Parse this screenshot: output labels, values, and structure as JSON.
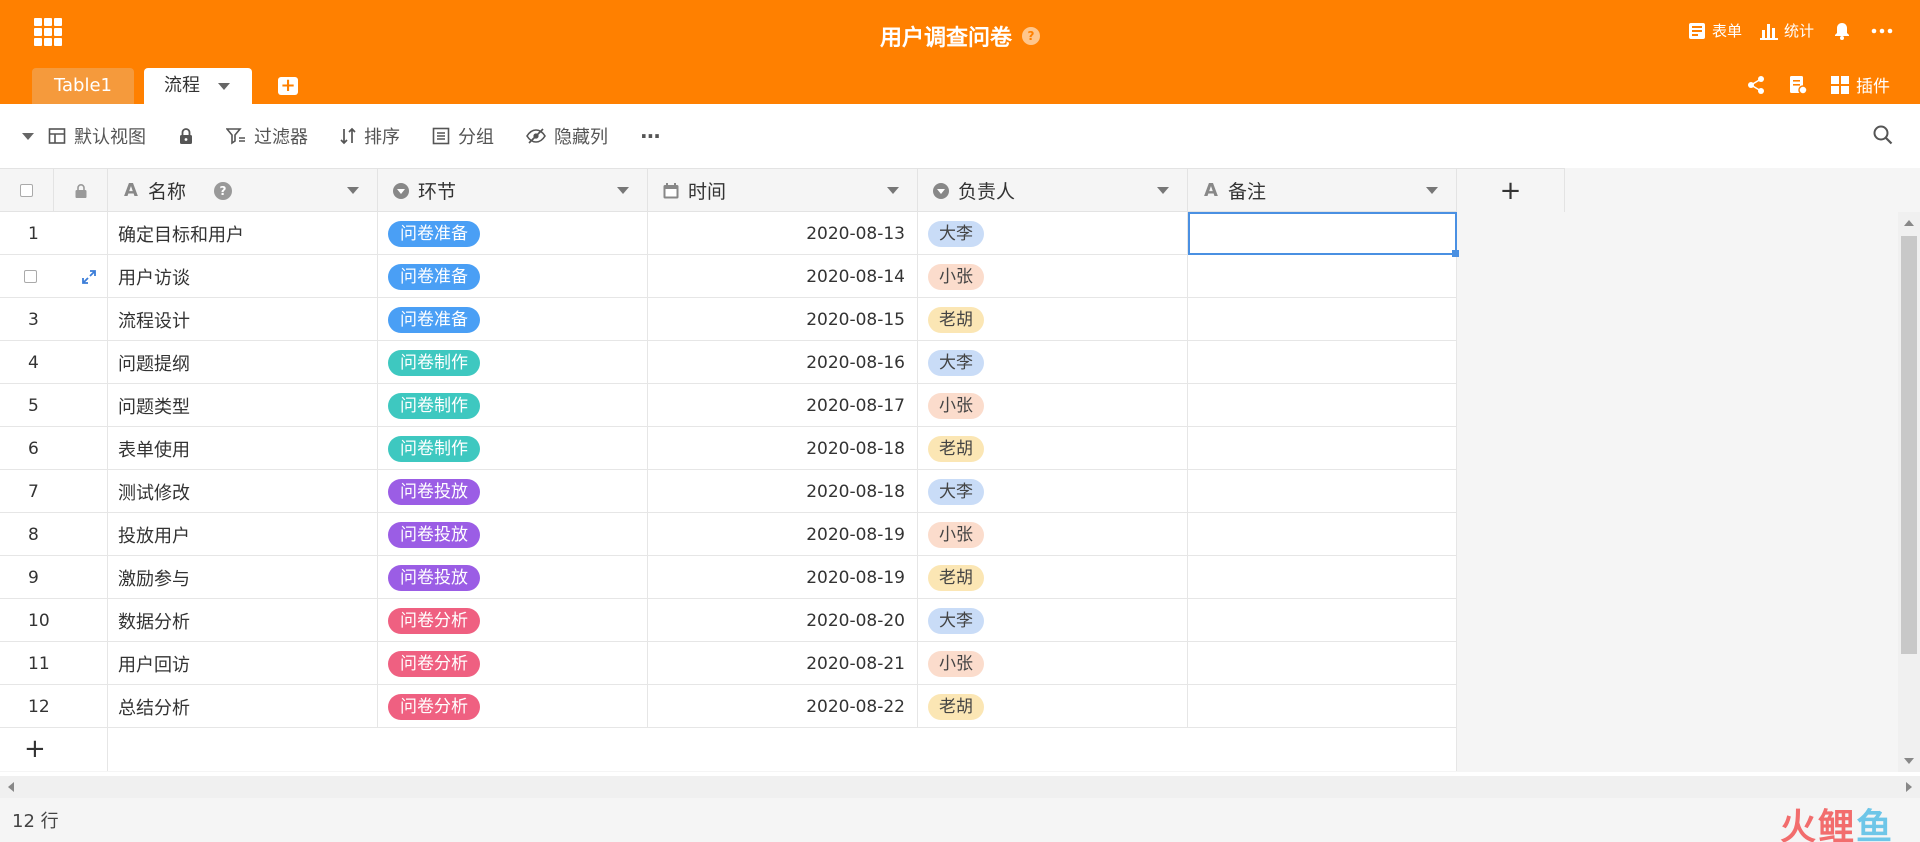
{
  "header": {
    "title": "用户调查问卷",
    "info_icon": "?",
    "actions": [
      {
        "icon": "form-icon",
        "label": "表单"
      },
      {
        "icon": "stats-icon",
        "label": "统计"
      }
    ],
    "secondary_actions": {
      "plugins_label": "插件"
    }
  },
  "tabs": [
    {
      "label": "Table1",
      "active": false
    },
    {
      "label": "流程",
      "active": true
    }
  ],
  "toolbar": {
    "view_label": "默认视图",
    "filter_label": "过滤器",
    "sort_label": "排序",
    "group_label": "分组",
    "hidden_label": "隐藏列",
    "more_label": "···"
  },
  "columns": {
    "name": "名称",
    "name_help": "?",
    "stage": "环节",
    "time": "时间",
    "owner": "负责人",
    "note": "备注",
    "add": "+"
  },
  "stage_colors": {
    "问卷准备": "#4a9ff5",
    "问卷制作": "#3ec8c0",
    "问卷投放": "#9b5de5",
    "问卷分析": "#ef6081"
  },
  "owner_colors": {
    "大李": "#c9dcf7",
    "小张": "#fbdccc",
    "老胡": "#fbe6b4"
  },
  "rows": [
    {
      "num": "1",
      "name": "确定目标和用户",
      "stage": "问卷准备",
      "date": "2020-08-13",
      "owner": "大李",
      "note": ""
    },
    {
      "num": "",
      "name": "用户访谈",
      "stage": "问卷准备",
      "date": "2020-08-14",
      "owner": "小张",
      "note": ""
    },
    {
      "num": "3",
      "name": "流程设计",
      "stage": "问卷准备",
      "date": "2020-08-15",
      "owner": "老胡",
      "note": ""
    },
    {
      "num": "4",
      "name": "问题提纲",
      "stage": "问卷制作",
      "date": "2020-08-16",
      "owner": "大李",
      "note": ""
    },
    {
      "num": "5",
      "name": "问题类型",
      "stage": "问卷制作",
      "date": "2020-08-17",
      "owner": "小张",
      "note": ""
    },
    {
      "num": "6",
      "name": "表单使用",
      "stage": "问卷制作",
      "date": "2020-08-18",
      "owner": "老胡",
      "note": ""
    },
    {
      "num": "7",
      "name": "测试修改",
      "stage": "问卷投放",
      "date": "2020-08-18",
      "owner": "大李",
      "note": ""
    },
    {
      "num": "8",
      "name": "投放用户",
      "stage": "问卷投放",
      "date": "2020-08-19",
      "owner": "小张",
      "note": ""
    },
    {
      "num": "9",
      "name": "激励参与",
      "stage": "问卷投放",
      "date": "2020-08-19",
      "owner": "老胡",
      "note": ""
    },
    {
      "num": "10",
      "name": "数据分析",
      "stage": "问卷分析",
      "date": "2020-08-20",
      "owner": "大李",
      "note": ""
    },
    {
      "num": "11",
      "name": "用户回访",
      "stage": "问卷分析",
      "date": "2020-08-21",
      "owner": "小张",
      "note": ""
    },
    {
      "num": "12",
      "name": "总结分析",
      "stage": "问卷分析",
      "date": "2020-08-22",
      "owner": "老胡",
      "note": ""
    }
  ],
  "add_row_label": "+",
  "footer": {
    "row_count": "12 行"
  },
  "watermark": {
    "part1": "火鲤",
    "part2": "鱼"
  }
}
